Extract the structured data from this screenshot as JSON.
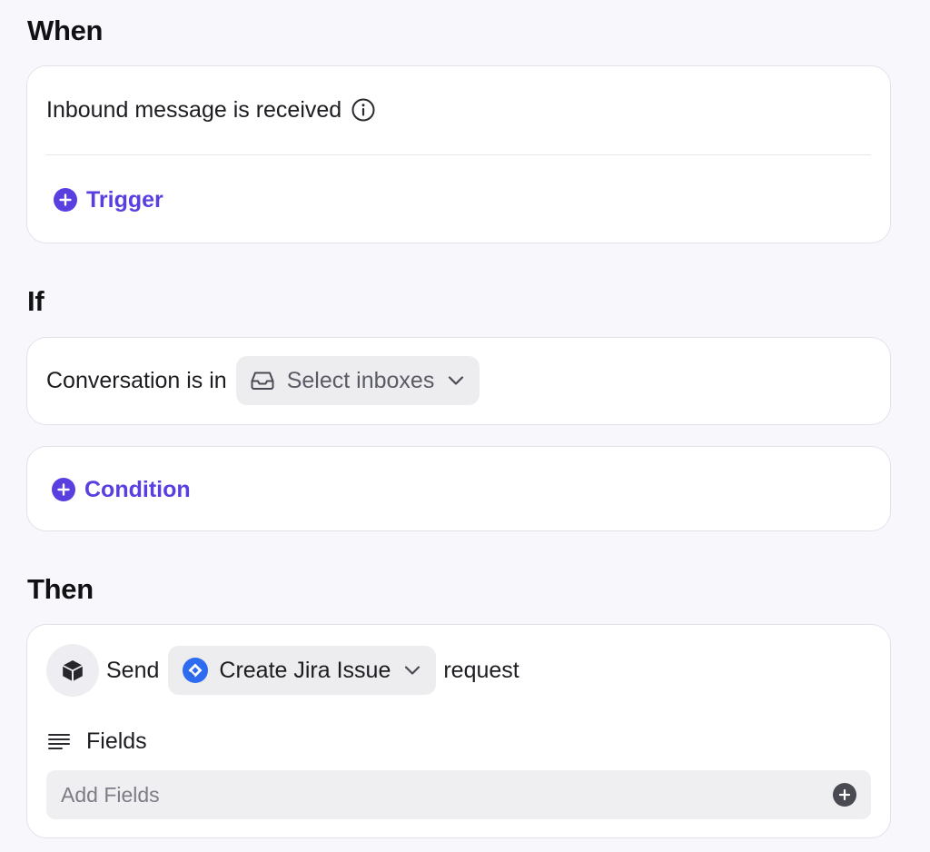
{
  "when": {
    "heading": "When",
    "trigger_text": "Inbound message is received",
    "add_trigger_label": "Trigger"
  },
  "if": {
    "heading": "If",
    "condition_prefix": "Conversation is in",
    "inbox_select": "Select inboxes",
    "add_condition_label": "Condition"
  },
  "then": {
    "heading": "Then",
    "send_label": "Send",
    "request_select": "Create Jira Issue",
    "request_suffix": "request",
    "fields_label": "Fields",
    "add_fields_placeholder": "Add Fields"
  },
  "colors": {
    "accent": "#5a3fe0",
    "jira": "#2d6cf0",
    "background": "#f8f7fc"
  },
  "icons": [
    "info-icon",
    "plus-circle-icon",
    "inbox-tray-icon",
    "chevron-down-icon",
    "package-box-icon",
    "jira-logo-icon",
    "lines-icon"
  ]
}
